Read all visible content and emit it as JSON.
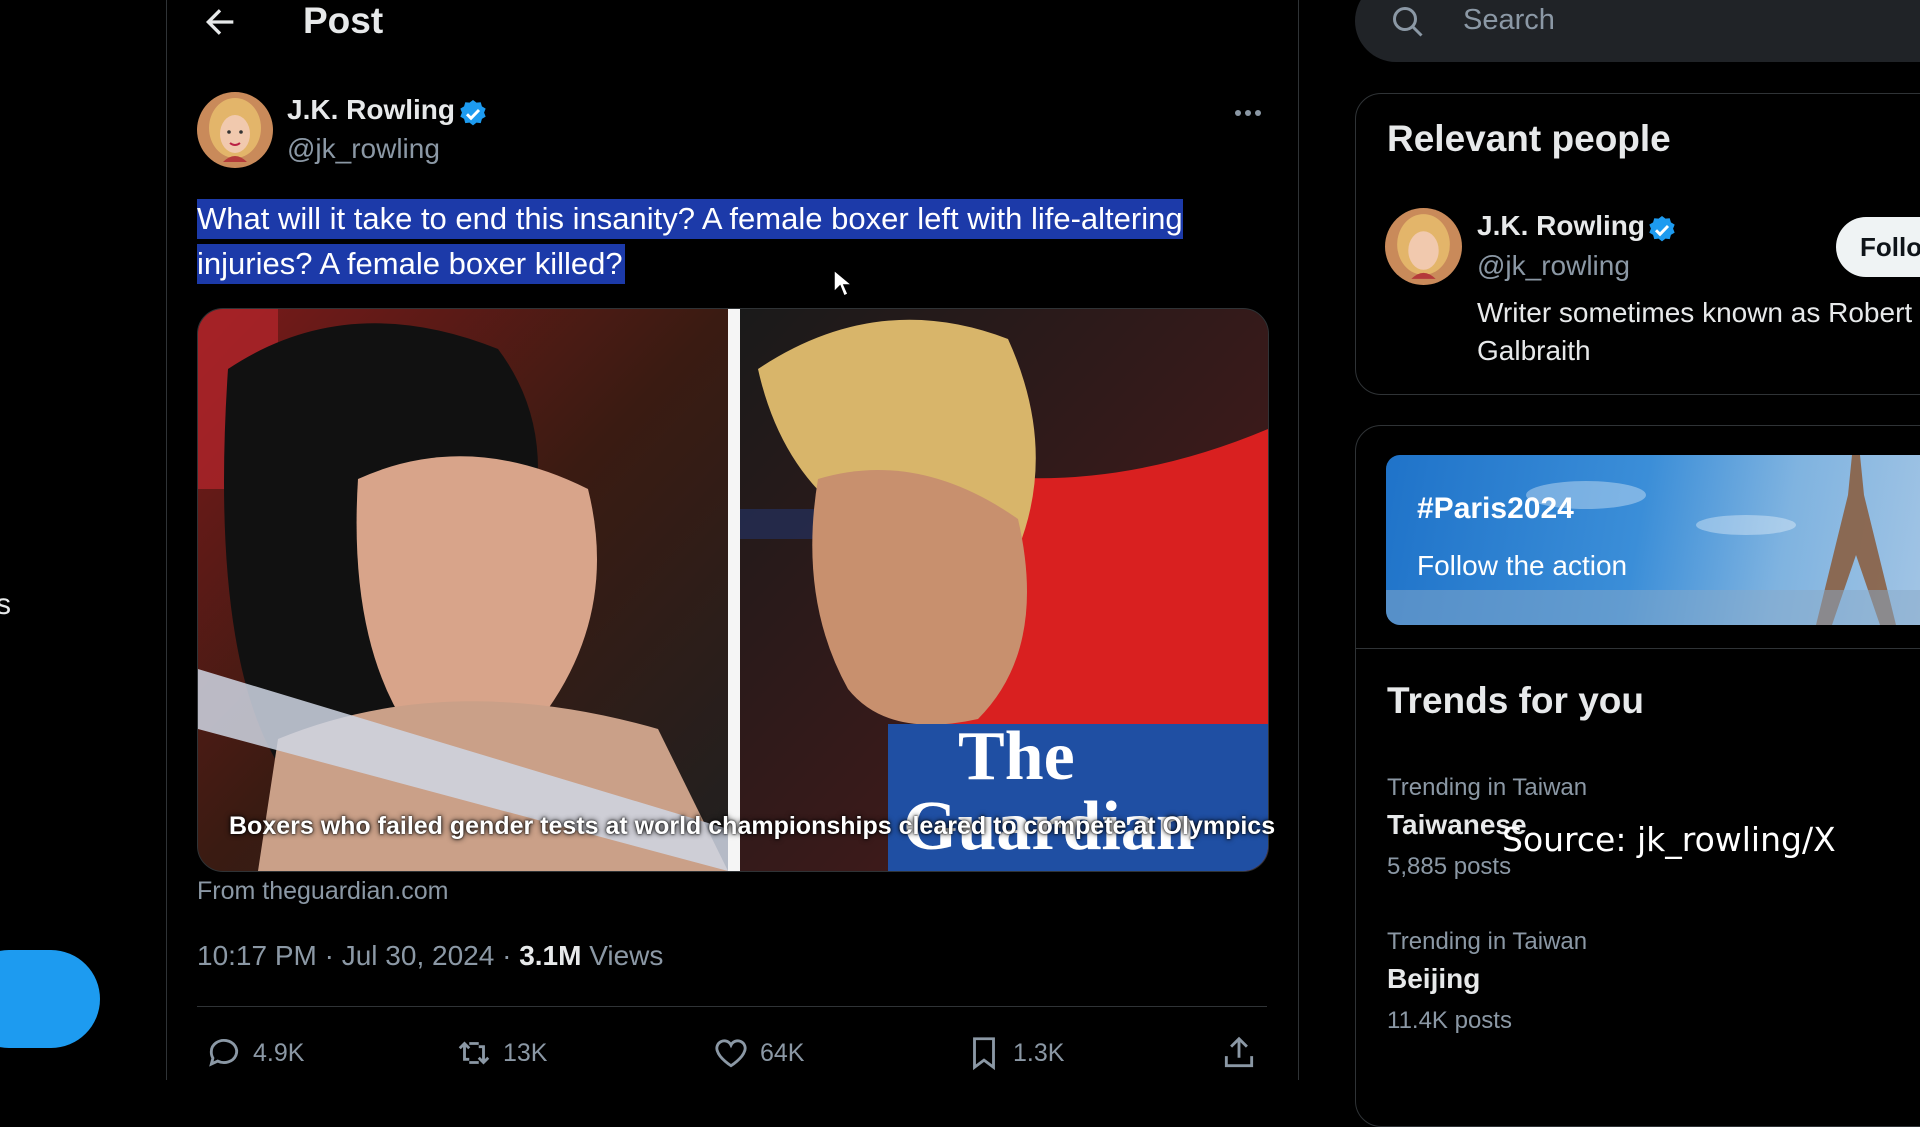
{
  "header": {
    "title": "Post"
  },
  "left_nav": {
    "partial_glyph": "s"
  },
  "tweet": {
    "author_name": "J.K. Rowling",
    "handle": "@jk_rowling",
    "text": "What will it take to end this insanity? A  female boxer left with life-altering injuries? A female boxer killed?",
    "media_caption": "Boxers who failed gender tests at world championships cleared to compete at Olympics",
    "media_logo_lines": [
      "The",
      "Guardian"
    ],
    "source": "From theguardian.com",
    "time": "10:17 PM · Jul 30, 2024 · ",
    "views_count": "3.1M",
    "views_label": " Views",
    "actions": {
      "replies": "4.9K",
      "reposts": "13K",
      "likes": "64K",
      "bookmarks": "1.3K"
    }
  },
  "search": {
    "placeholder": "Search"
  },
  "relevant_people": {
    "title": "Relevant people",
    "person": {
      "name": "J.K. Rowling",
      "handle": "@jk_rowling",
      "bio": "Writer sometimes known as Robert Galbraith",
      "follow_label": "Follow"
    }
  },
  "promo": {
    "hashtag": "#Paris2024",
    "subtitle": "Follow the action"
  },
  "trends": {
    "title": "Trends for you",
    "items": [
      {
        "meta": "Trending in Taiwan",
        "name": "Taiwanese",
        "count": "5,885 posts"
      },
      {
        "meta": "Trending in Taiwan",
        "name": "Beijing",
        "count": "11.4K posts"
      }
    ]
  },
  "watermark": "Source: jk_rowling/X",
  "colors": {
    "accent": "#1d9bf0",
    "selection": "#1c3aa9",
    "background": "#000000"
  }
}
